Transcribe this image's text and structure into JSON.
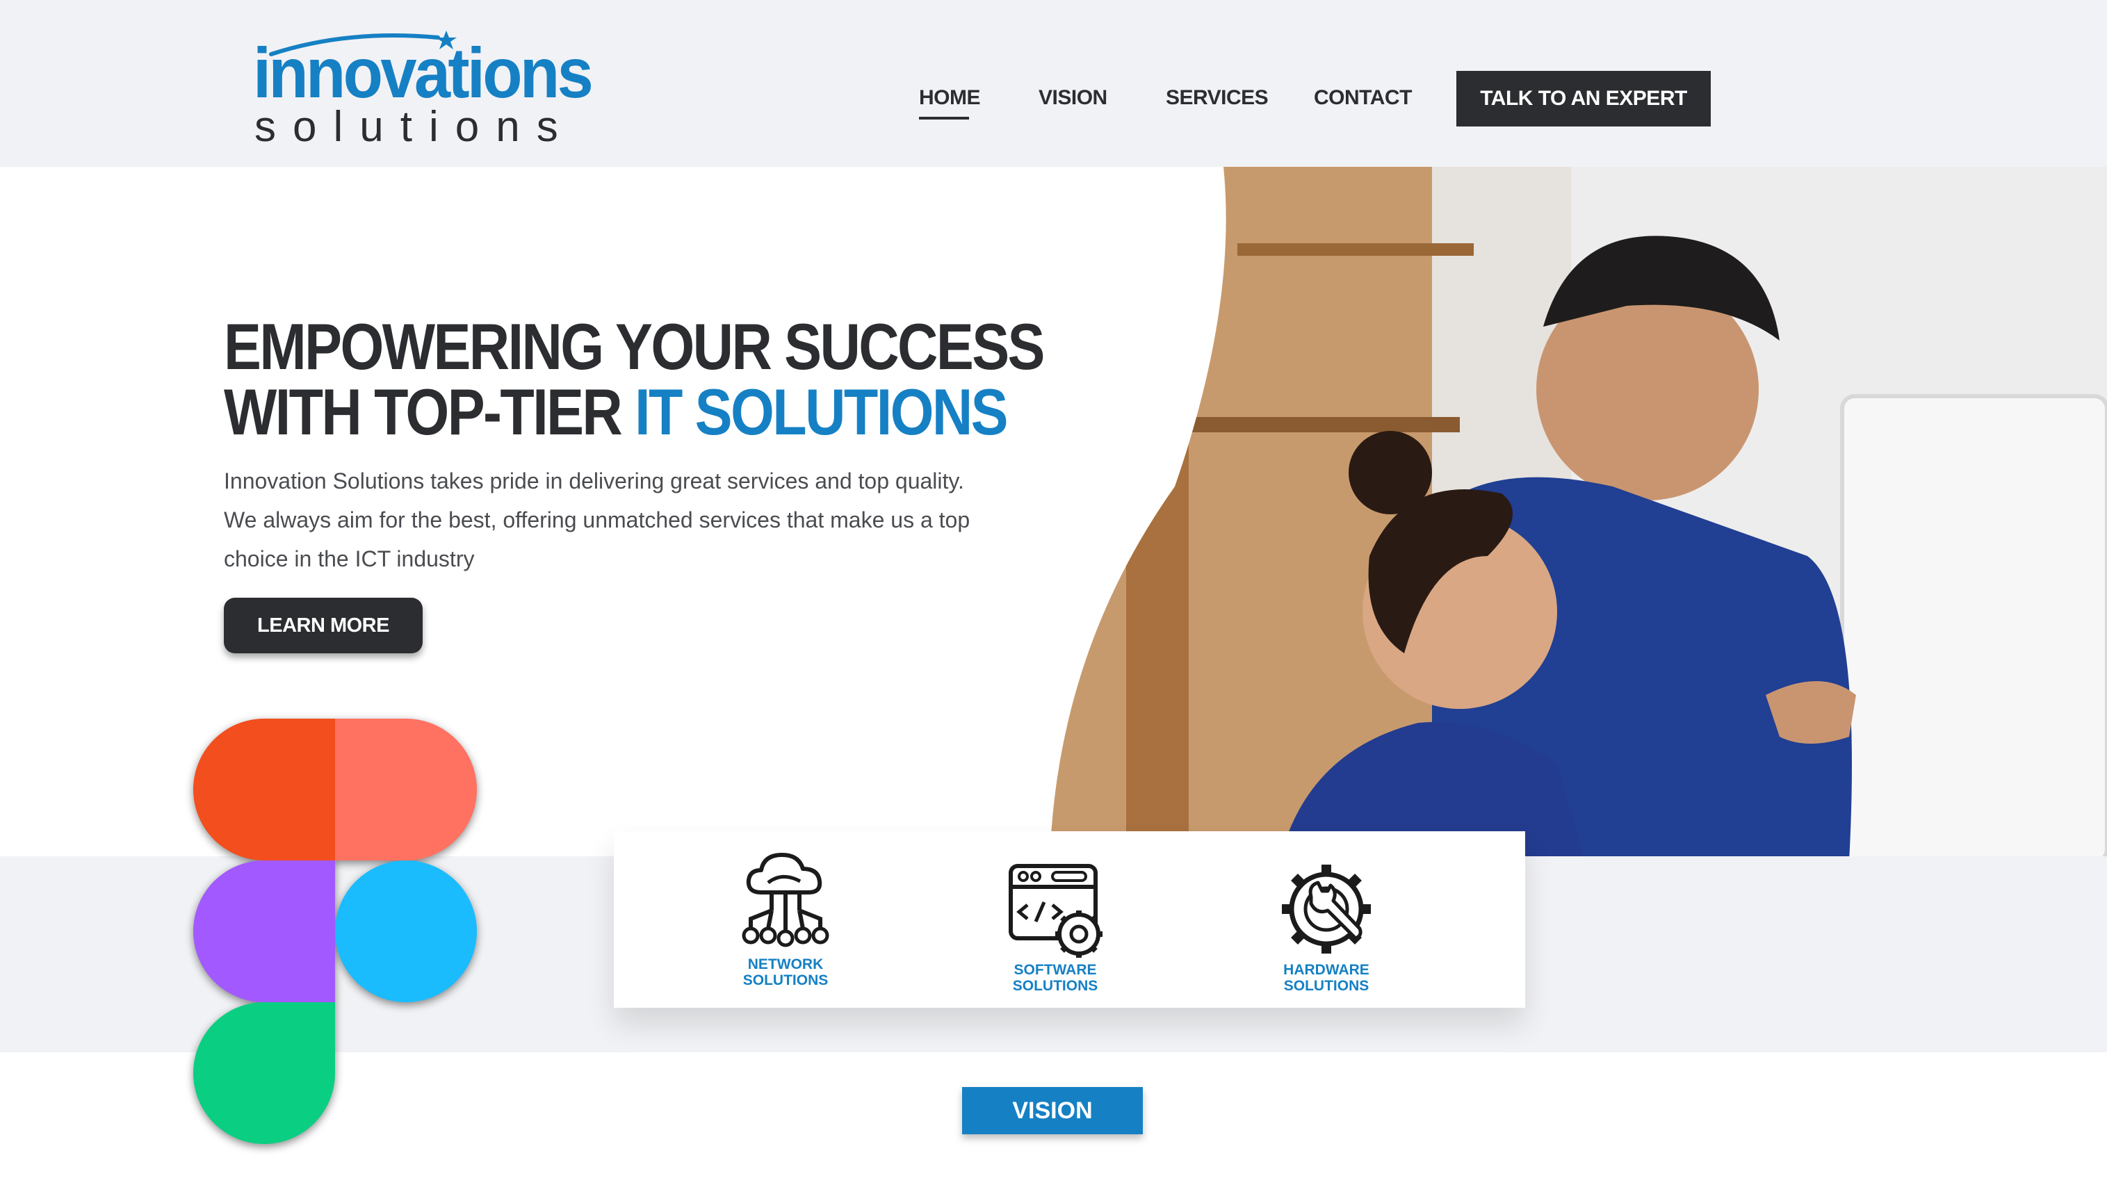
{
  "brand": {
    "name_top": "innovations",
    "name_bottom": "solutions",
    "primary_color": "#1680c4",
    "dark_color": "#2b2d30"
  },
  "nav": {
    "items": [
      {
        "label": "HOME",
        "active": true
      },
      {
        "label": "VISION",
        "active": false
      },
      {
        "label": "SERVICES",
        "active": false
      },
      {
        "label": "CONTACT",
        "active": false
      }
    ],
    "cta_label": "TALK TO AN EXPERT"
  },
  "hero": {
    "headline_line1": "EMPOWERING YOUR SUCCESS",
    "headline_line2_prefix": "WITH TOP-TIER ",
    "headline_line2_accent": "IT SOLUTIONS",
    "intro_line1": "Innovation Solutions takes pride in delivering great services and top quality.",
    "intro_line2": "We always aim for the best, offering unmatched services that make us a top",
    "intro_line3": "choice in the ICT industry",
    "button_label": "LEARN MORE"
  },
  "services": [
    {
      "icon": "cloud-network-icon",
      "line1": "NETWORK",
      "line2": "SOLUTIONS"
    },
    {
      "icon": "code-gear-icon",
      "line1": "SOFTWARE",
      "line2": "SOLUTIONS"
    },
    {
      "icon": "gear-wrench-icon",
      "line1": "HARDWARE",
      "line2": "SOLUTIONS"
    }
  ],
  "vision_button_label": "VISION",
  "figma_logo": {
    "colors": [
      "#f24e1e",
      "#ff7262",
      "#a259ff",
      "#1abcfe",
      "#0acf83"
    ]
  }
}
